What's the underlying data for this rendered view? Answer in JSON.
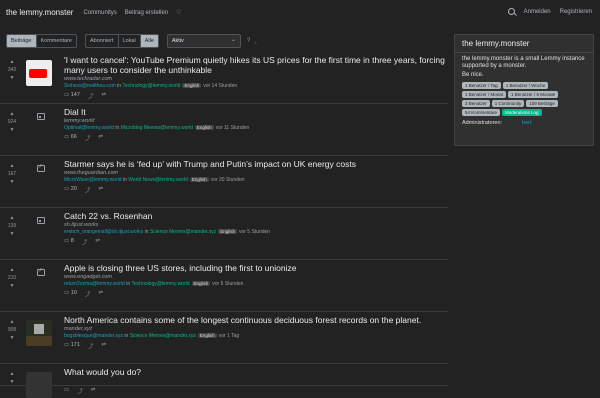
{
  "nav": {
    "brand": "the lemmy.monster",
    "links": [
      "Communitys",
      "Beitrag erstellen",
      "♡"
    ],
    "login": "Anmelden",
    "register": "Registrieren"
  },
  "toolbar": {
    "type_options": [
      "Beiträge",
      "Kommentare"
    ],
    "listing_options": [
      "Abonniert",
      "Lokal",
      "Alle"
    ],
    "sort_value": "Aktiv"
  },
  "posts": [
    {
      "score": "343",
      "title": "'I want to cancel': YouTube Premium quietly hikes its US prices for the first time in three years, forcing many users to consider the unthinkable",
      "domain": "www.techradar.com",
      "user": "Sixhexa@realthea.com",
      "in": "in",
      "community": "Technology@lemmy.world",
      "lang": "English",
      "time": "vor 14 Stunden",
      "comments": "147",
      "thumb": "yt",
      "color": "#e4e4e4"
    },
    {
      "score": "924",
      "title": "Dial It",
      "domain": "lemmy.world",
      "user": "Optimal@lemmy.world",
      "in": "in",
      "community": "Microblog Memes@lemmy.world",
      "lang": "English",
      "time": "vor 11 Stunden",
      "comments": "66",
      "thumb": "img"
    },
    {
      "score": "167",
      "title": "Starmer says he is ‘fed up’ with Trump and Putin’s impact on UK energy costs",
      "domain": "www.theguardian.com",
      "user": "MicroWave@lemmy.world",
      "in": "in",
      "community": "World News@lemmy.world",
      "lang": "English",
      "time": "vor 20 Stunden",
      "comments": "20",
      "thumb": "link"
    },
    {
      "score": "139",
      "title": "Catch 22 vs. Rosenhan",
      "domain": "sh.itjust.works",
      "user": "erebch_orangemall@sh.itjust.works",
      "in": "in",
      "community": "Science Memes@mander.xyz",
      "lang": "English",
      "time": "vor 5 Stunden",
      "comments": "8",
      "thumb": "img"
    },
    {
      "score": "210",
      "title": "Apple is closing three US stores, including the first to unionize",
      "domain": "www.engadget.com",
      "user": "return2ozma@lemmy.world",
      "in": "in",
      "community": "Technology@lemmy.world",
      "lang": "English",
      "time": "vor 6 Stunden",
      "comments": "10",
      "thumb": "link"
    },
    {
      "score": "908",
      "title": "North America contains some of the longest continuous deciduous forest records on the planet.",
      "domain": "mander.xyz",
      "user": "bogsblesque@mander.xyz",
      "in": "in",
      "community": "Science Memes@mander.xyz",
      "lang": "English",
      "time": "vor 1 Tag",
      "comments": "171",
      "thumb": "photo"
    },
    {
      "score": "",
      "title": "What would you do?",
      "domain": "",
      "user": "",
      "in": "",
      "community": "",
      "lang": "",
      "time": "",
      "comments": "",
      "thumb": "photo2"
    }
  ],
  "sidebar": {
    "title": "the lemmy.monster",
    "description": "the lemmy.monster is a small Lemmy instance supported by a monster.",
    "nice": "Be nice.",
    "stats": [
      "1 Benutzer / Tag",
      "1 Benutzer / Woche",
      "1 Benutzer / Monat",
      "1 Benutzer / 6 Monate",
      "3 Benutzer",
      "1 Community",
      "109 Beiträge",
      "54 Kommentare",
      "Moderations Log"
    ],
    "admins_label": "Administratoren:",
    "admin": "bert"
  }
}
